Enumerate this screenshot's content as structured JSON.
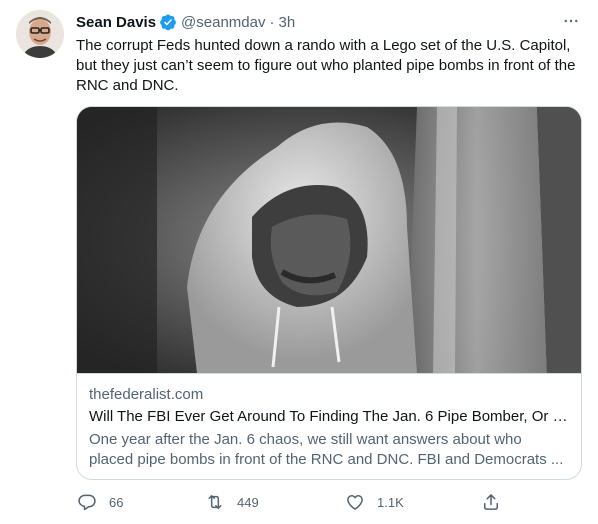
{
  "tweet": {
    "author": {
      "name": "Sean Davis",
      "handle": "@seanmdav",
      "verified": true,
      "avatar_icon": "avatar-photo"
    },
    "separator": "·",
    "time": "3h",
    "text": "The corrupt Feds hunted down a rando with a Lego set of the U.S. Capitol, but they just can’t seem to figure out who planted pipe bombs in front of the RNC and DNC.",
    "card": {
      "domain": "thefederalist.com",
      "title": "Will The FBI Ever Get Around To Finding The Jan. 6 Pipe Bomber, Or N...",
      "description_line1": "One year after the Jan. 6 chaos, we still want answers about who",
      "description_line2": "placed pipe bombs in front of the RNC and DNC. FBI and Democrats ..."
    },
    "actions": {
      "replies": "66",
      "retweets": "449",
      "likes": "1.1K"
    }
  },
  "colors": {
    "text": "#0f1419",
    "secondary": "#536471",
    "verified": "#1d9bf0",
    "border": "#cfd9de"
  }
}
